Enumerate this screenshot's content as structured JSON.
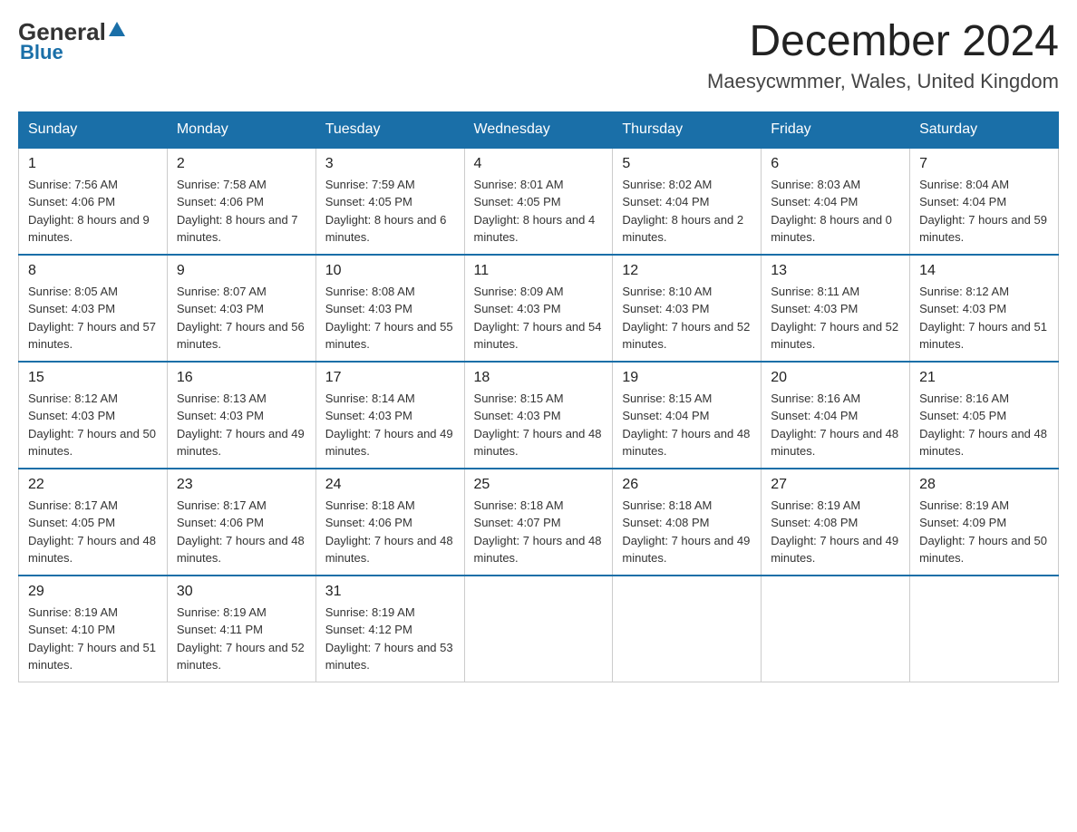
{
  "header": {
    "logo_general": "General",
    "logo_blue": "Blue",
    "main_title": "December 2024",
    "subtitle": "Maesycwmmer, Wales, United Kingdom"
  },
  "calendar": {
    "days_of_week": [
      "Sunday",
      "Monday",
      "Tuesday",
      "Wednesday",
      "Thursday",
      "Friday",
      "Saturday"
    ],
    "weeks": [
      [
        {
          "day": "1",
          "sunrise": "7:56 AM",
          "sunset": "4:06 PM",
          "daylight": "8 hours and 9 minutes."
        },
        {
          "day": "2",
          "sunrise": "7:58 AM",
          "sunset": "4:06 PM",
          "daylight": "8 hours and 7 minutes."
        },
        {
          "day": "3",
          "sunrise": "7:59 AM",
          "sunset": "4:05 PM",
          "daylight": "8 hours and 6 minutes."
        },
        {
          "day": "4",
          "sunrise": "8:01 AM",
          "sunset": "4:05 PM",
          "daylight": "8 hours and 4 minutes."
        },
        {
          "day": "5",
          "sunrise": "8:02 AM",
          "sunset": "4:04 PM",
          "daylight": "8 hours and 2 minutes."
        },
        {
          "day": "6",
          "sunrise": "8:03 AM",
          "sunset": "4:04 PM",
          "daylight": "8 hours and 0 minutes."
        },
        {
          "day": "7",
          "sunrise": "8:04 AM",
          "sunset": "4:04 PM",
          "daylight": "7 hours and 59 minutes."
        }
      ],
      [
        {
          "day": "8",
          "sunrise": "8:05 AM",
          "sunset": "4:03 PM",
          "daylight": "7 hours and 57 minutes."
        },
        {
          "day": "9",
          "sunrise": "8:07 AM",
          "sunset": "4:03 PM",
          "daylight": "7 hours and 56 minutes."
        },
        {
          "day": "10",
          "sunrise": "8:08 AM",
          "sunset": "4:03 PM",
          "daylight": "7 hours and 55 minutes."
        },
        {
          "day": "11",
          "sunrise": "8:09 AM",
          "sunset": "4:03 PM",
          "daylight": "7 hours and 54 minutes."
        },
        {
          "day": "12",
          "sunrise": "8:10 AM",
          "sunset": "4:03 PM",
          "daylight": "7 hours and 52 minutes."
        },
        {
          "day": "13",
          "sunrise": "8:11 AM",
          "sunset": "4:03 PM",
          "daylight": "7 hours and 52 minutes."
        },
        {
          "day": "14",
          "sunrise": "8:12 AM",
          "sunset": "4:03 PM",
          "daylight": "7 hours and 51 minutes."
        }
      ],
      [
        {
          "day": "15",
          "sunrise": "8:12 AM",
          "sunset": "4:03 PM",
          "daylight": "7 hours and 50 minutes."
        },
        {
          "day": "16",
          "sunrise": "8:13 AM",
          "sunset": "4:03 PM",
          "daylight": "7 hours and 49 minutes."
        },
        {
          "day": "17",
          "sunrise": "8:14 AM",
          "sunset": "4:03 PM",
          "daylight": "7 hours and 49 minutes."
        },
        {
          "day": "18",
          "sunrise": "8:15 AM",
          "sunset": "4:03 PM",
          "daylight": "7 hours and 48 minutes."
        },
        {
          "day": "19",
          "sunrise": "8:15 AM",
          "sunset": "4:04 PM",
          "daylight": "7 hours and 48 minutes."
        },
        {
          "day": "20",
          "sunrise": "8:16 AM",
          "sunset": "4:04 PM",
          "daylight": "7 hours and 48 minutes."
        },
        {
          "day": "21",
          "sunrise": "8:16 AM",
          "sunset": "4:05 PM",
          "daylight": "7 hours and 48 minutes."
        }
      ],
      [
        {
          "day": "22",
          "sunrise": "8:17 AM",
          "sunset": "4:05 PM",
          "daylight": "7 hours and 48 minutes."
        },
        {
          "day": "23",
          "sunrise": "8:17 AM",
          "sunset": "4:06 PM",
          "daylight": "7 hours and 48 minutes."
        },
        {
          "day": "24",
          "sunrise": "8:18 AM",
          "sunset": "4:06 PM",
          "daylight": "7 hours and 48 minutes."
        },
        {
          "day": "25",
          "sunrise": "8:18 AM",
          "sunset": "4:07 PM",
          "daylight": "7 hours and 48 minutes."
        },
        {
          "day": "26",
          "sunrise": "8:18 AM",
          "sunset": "4:08 PM",
          "daylight": "7 hours and 49 minutes."
        },
        {
          "day": "27",
          "sunrise": "8:19 AM",
          "sunset": "4:08 PM",
          "daylight": "7 hours and 49 minutes."
        },
        {
          "day": "28",
          "sunrise": "8:19 AM",
          "sunset": "4:09 PM",
          "daylight": "7 hours and 50 minutes."
        }
      ],
      [
        {
          "day": "29",
          "sunrise": "8:19 AM",
          "sunset": "4:10 PM",
          "daylight": "7 hours and 51 minutes."
        },
        {
          "day": "30",
          "sunrise": "8:19 AM",
          "sunset": "4:11 PM",
          "daylight": "7 hours and 52 minutes."
        },
        {
          "day": "31",
          "sunrise": "8:19 AM",
          "sunset": "4:12 PM",
          "daylight": "7 hours and 53 minutes."
        },
        null,
        null,
        null,
        null
      ]
    ]
  }
}
